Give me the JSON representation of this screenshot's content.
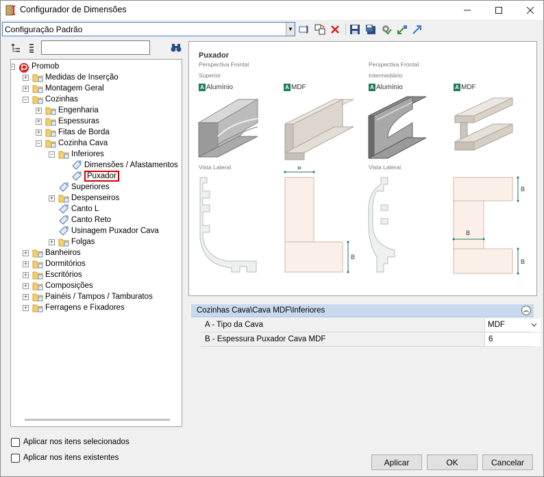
{
  "window": {
    "title": "Configurador de Dimensões"
  },
  "toolbar": {
    "config_value": "Configuração Padrão"
  },
  "tree": {
    "root": "Promob",
    "items": [
      "Medidas de Inserção",
      "Montagem Geral",
      "Cozinhas",
      "Engenharia",
      "Espessuras",
      "Fitas de Borda",
      "Cozinha Cava",
      "Inferiores",
      "Dimensões / Afastamentos",
      "Puxador",
      "Superiores",
      "Despenseiros",
      "Canto L",
      "Canto Reto",
      "Usinagem Puxador Cava",
      "Folgas",
      "Banheiros",
      "Dormitórios",
      "Escritórios",
      "Composições",
      "Painéis / Tampos / Tamburatos",
      "Ferragens e Fixadores"
    ]
  },
  "preview": {
    "title": "Puxador",
    "col1_sub1": "Perspectiva Frontal",
    "col1_sub2": "Superior",
    "col2_sub1": "Perspectiva Frontal",
    "col2_sub2": "Intermediário",
    "material_a": "A",
    "mat1": "Alumínio",
    "mat2": "MDF",
    "mat3": "Alumínio",
    "mat4": "MDF",
    "side_label_1": "Vista Lateral",
    "side_label_2": "Vista Lateral",
    "dim_b": "B",
    "accent": "#1e7a5a"
  },
  "properties": {
    "header": "Cozinhas Cava\\Cava MDF\\Inferiores",
    "rows": [
      {
        "name": "A - Tipo da Cava",
        "value": "MDF"
      },
      {
        "name": "B - Espessura Puxador Cava MDF",
        "value": "6"
      }
    ]
  },
  "options": {
    "apply_selected": "Aplicar nos itens selecionados",
    "apply_existing": "Aplicar nos itens existentes"
  },
  "buttons": {
    "apply": "Aplicar",
    "ok": "OK",
    "cancel": "Cancelar"
  }
}
